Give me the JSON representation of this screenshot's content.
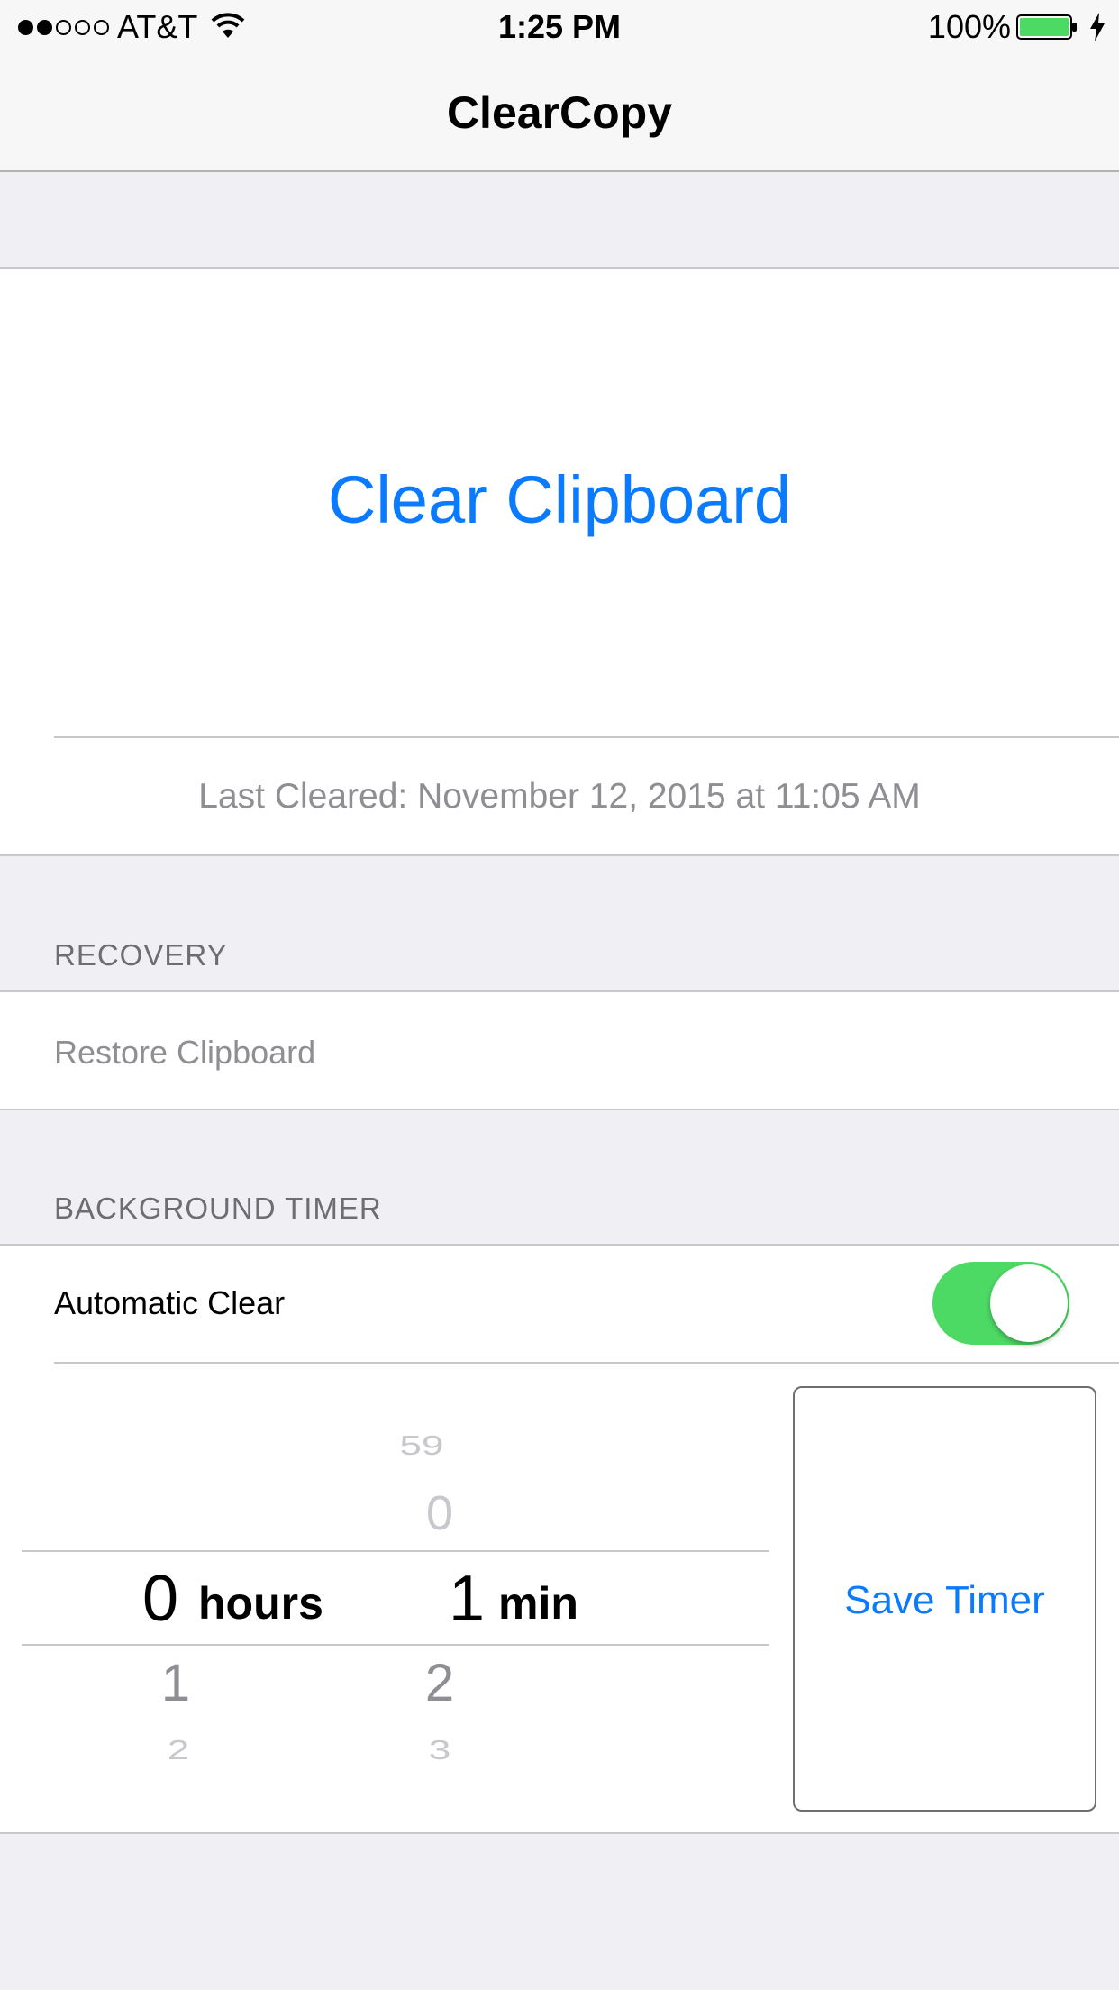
{
  "status_bar": {
    "carrier": "AT&T",
    "time": "1:25 PM",
    "battery_percent": "100%",
    "signal_bars_filled": 2,
    "signal_bars_total": 5
  },
  "nav": {
    "title": "ClearCopy"
  },
  "main": {
    "clear_button_label": "Clear Clipboard",
    "last_cleared": "Last Cleared: November 12, 2015 at 11:05 AM"
  },
  "recovery": {
    "header": "RECOVERY",
    "restore_label": "Restore Clipboard"
  },
  "background_timer": {
    "header": "BACKGROUND TIMER",
    "automatic_clear_label": "Automatic Clear",
    "automatic_clear_on": true
  },
  "picker": {
    "hours": {
      "selected": "0",
      "unit": "hours",
      "below": [
        "1",
        "2"
      ]
    },
    "minutes": {
      "above": [
        "59",
        "0"
      ],
      "selected": "1",
      "unit": "min",
      "below": [
        "2",
        "3"
      ]
    }
  },
  "save_timer_label": "Save Timer",
  "colors": {
    "accent": "#0a7aff",
    "switch_on": "#4cd964",
    "battery": "#4cd964",
    "background": "#efeff4"
  }
}
